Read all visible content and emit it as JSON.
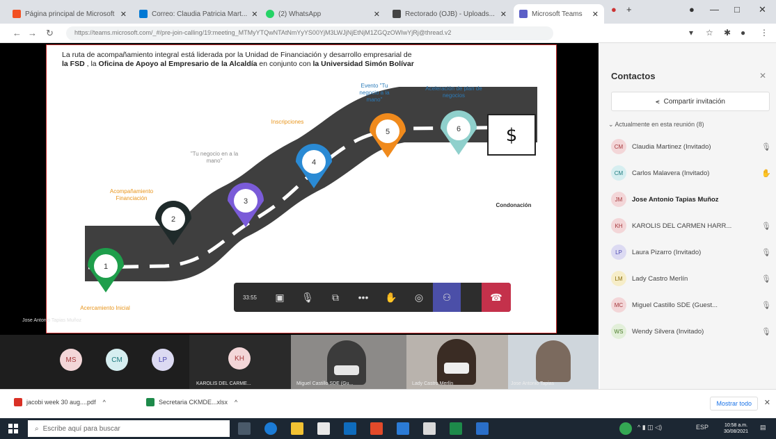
{
  "browser": {
    "tabs": [
      {
        "label": "Página principal de Microsoft"
      },
      {
        "label": "Correo: Claudia Patricia Mart..."
      },
      {
        "label": "(2) WhatsApp"
      },
      {
        "label": "Rectorado (OJB) - Uploads..."
      },
      {
        "label": "Microsoft Teams"
      }
    ],
    "url": "https://teams.microsoft.com/_#/pre-join-calling/19:meeting_MTMyYTQwNTAtNmYyYS00YjM3LWJjNjEtNjM1ZGQzOWIwYjRj@thread.v2"
  },
  "slide": {
    "intro_1": "La ruta de acompañamiento integral está liderada por la Unidad de Financiación y desarrollo empresarial de",
    "intro_fsd": "la FSD",
    "intro_2": " , la ",
    "intro_oficina": "Oficina de Apoyo al Empresario de la Alcaldía",
    "intro_3": " en conjunto con ",
    "intro_usb": "la Universidad Simón Bolívar",
    "markers": [
      {
        "num": "1",
        "color": "#1e9e4b"
      },
      {
        "num": "2",
        "color": "#1f2a2a"
      },
      {
        "num": "3",
        "color": "#7a5bd8"
      },
      {
        "num": "4",
        "color": "#2a8ad4"
      },
      {
        "num": "5",
        "color": "#f08a1c"
      },
      {
        "num": "6",
        "color": "#8fd0cc"
      }
    ],
    "labels": {
      "m1": "Acercamiento Inicial",
      "m2": "Acompañamiento Financiación",
      "m3": "\"Tu negocio en a la mano\"",
      "m4": "Inscripciones",
      "m5": "Evento \"Tu negocio a la mano\"",
      "m6": "Aceleración de plan de negocios",
      "end": "Condonación"
    }
  },
  "toolbar": {
    "time": "33:55"
  },
  "presenter_caption": "Jose Antonio Tapias Muñoz",
  "sidebar": {
    "title": "Contactos",
    "share": "Compartir invitación",
    "meeting_label": "Actualmente en esta reunión (8)",
    "people": [
      {
        "initials": "CM",
        "name": "Claudia Martinez (Invitado)",
        "bg": "#f3d6d8",
        "fg": "#a4373a"
      },
      {
        "initials": "CM",
        "name": "Carlos Malavera (Invitado)",
        "bg": "#d6eef0",
        "fg": "#1e7a7e"
      },
      {
        "initials": "JM",
        "name": "Jose Antonio Tapias Muñoz",
        "bg": "#f3d6d8",
        "fg": "#a4373a"
      },
      {
        "initials": "KH",
        "name": "KAROLIS DEL CARMEN HARR...",
        "bg": "#f3d6d8",
        "fg": "#a4373a"
      },
      {
        "initials": "LP",
        "name": "Laura Pizarro (Invitado)",
        "bg": "#dcdaf2",
        "fg": "#4f4bb3"
      },
      {
        "initials": "LM",
        "name": "Lady Castro Merlín",
        "bg": "#f6edc8",
        "fg": "#8a6d0b"
      },
      {
        "initials": "MC",
        "name": "Miguel Castillo SDE (Guest...",
        "bg": "#f3d6d8",
        "fg": "#a4373a"
      },
      {
        "initials": "WS",
        "name": "Wendy Silvera (Invitado)",
        "bg": "#e2efd9",
        "fg": "#4b7a2a"
      }
    ]
  },
  "strip": {
    "circles": [
      {
        "initials": "MS",
        "bg": "#f3d6d8",
        "fg": "#a4373a"
      },
      {
        "initials": "CM",
        "bg": "#d6eef0",
        "fg": "#1e7a7e"
      },
      {
        "initials": "LP",
        "bg": "#dcdaf2",
        "fg": "#4f4bb3"
      }
    ],
    "kh": {
      "initials": "KH",
      "name": "KAROLIS DEL CARME..."
    },
    "videos": [
      {
        "name": "Miguel Castillo SDE (Gu..."
      },
      {
        "name": "Lady Castro Merlín"
      },
      {
        "name": "Jose Antonio Tapias"
      }
    ]
  },
  "downloads": {
    "items": [
      {
        "label": "jacobi week 30 aug....pdf"
      },
      {
        "label": "Secretaria CKMDE...xlsx"
      }
    ],
    "show_all": "Mostrar todo"
  },
  "taskbar": {
    "search": "Escribe aquí para buscar",
    "tray": "ESP",
    "time": "10:58 a.m.",
    "date": "30/08/2021"
  }
}
